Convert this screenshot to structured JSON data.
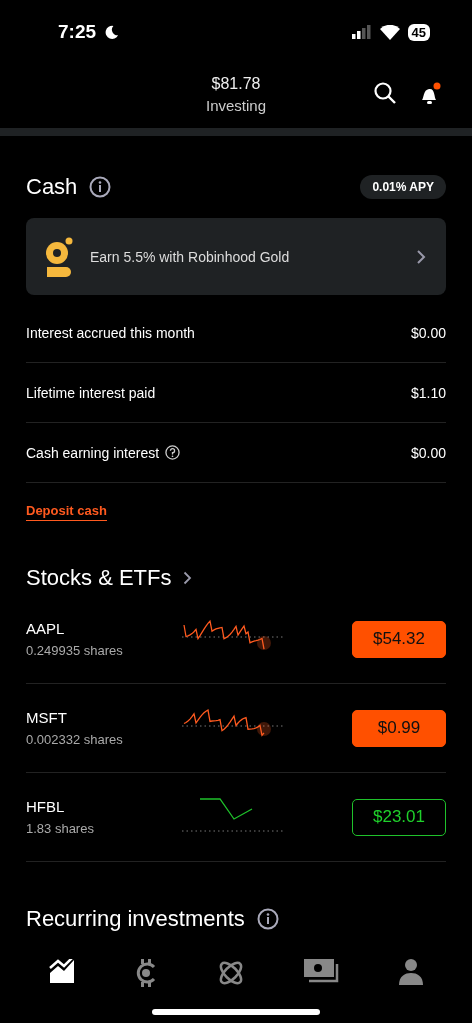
{
  "status_bar": {
    "time": "7:25",
    "battery": "45",
    "do_not_disturb": true
  },
  "header": {
    "value": "$81.78",
    "label": "Investing",
    "notification_dot": true
  },
  "cash": {
    "title": "Cash",
    "apy": "0.01% APY",
    "promo": "Earn 5.5% with Robinhood Gold",
    "rows": [
      {
        "label": "Interest accrued this month",
        "value": "$0.00",
        "help": false
      },
      {
        "label": "Lifetime interest paid",
        "value": "$1.10",
        "help": false
      },
      {
        "label": "Cash earning interest",
        "value": "$0.00",
        "help": true
      }
    ],
    "deposit": "Deposit cash"
  },
  "stocks": {
    "title": "Stocks & ETFs",
    "rows": [
      {
        "symbol": "AAPL",
        "shares": "0.249935 shares",
        "price": "$54.32",
        "up": false
      },
      {
        "symbol": "MSFT",
        "shares": "0.002332 shares",
        "price": "$0.99",
        "up": false
      },
      {
        "symbol": "HFBL",
        "shares": "1.83 shares",
        "price": "$23.01",
        "up": true
      }
    ]
  },
  "recurring": {
    "title": "Recurring investments"
  },
  "nav": [
    {
      "kind": "investing",
      "selected": true
    },
    {
      "kind": "crypto",
      "selected": false
    },
    {
      "kind": "network",
      "selected": false
    },
    {
      "kind": "cash",
      "selected": false
    },
    {
      "kind": "account",
      "selected": false
    }
  ]
}
